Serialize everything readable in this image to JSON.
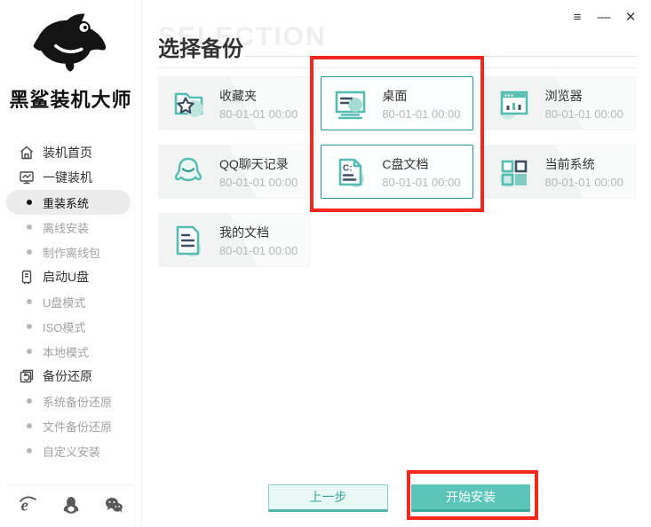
{
  "window": {
    "controls": {
      "menu": "≡",
      "minimize": "—",
      "close": "✕"
    }
  },
  "sidebar": {
    "app_name": "黑鲨装机大师",
    "logo_icon": "shark-logo",
    "items": [
      {
        "name": "home",
        "label": "装机首页",
        "type": "main",
        "icon": "home-icon"
      },
      {
        "name": "one-click-install",
        "label": "一键装机",
        "type": "main",
        "icon": "monitor-chart-icon"
      },
      {
        "name": "reinstall-system",
        "label": "重装系统",
        "type": "sub",
        "active": true
      },
      {
        "name": "offline-install",
        "label": "离线安装",
        "type": "sub"
      },
      {
        "name": "make-offline-package",
        "label": "制作离线包",
        "type": "sub"
      },
      {
        "name": "boot-usb",
        "label": "启动U盘",
        "type": "main",
        "icon": "usb-drive-icon"
      },
      {
        "name": "usb-mode",
        "label": "U盘模式",
        "type": "sub"
      },
      {
        "name": "iso-mode",
        "label": "ISO模式",
        "type": "sub"
      },
      {
        "name": "local-mode",
        "label": "本地模式",
        "type": "sub"
      },
      {
        "name": "backup-restore",
        "label": "备份还原",
        "type": "main",
        "icon": "backup-restore-icon"
      },
      {
        "name": "system-backup-restore",
        "label": "系统备份还原",
        "type": "sub"
      },
      {
        "name": "file-backup-restore",
        "label": "文件备份还原",
        "type": "sub"
      },
      {
        "name": "custom-install",
        "label": "自定义安装",
        "type": "sub"
      }
    ],
    "footer_icons": [
      "ie-browser-icon",
      "qq-icon",
      "wechat-icon"
    ]
  },
  "header": {
    "title": "选择备份",
    "watermark": "SELECTION"
  },
  "cards": [
    {
      "name": "favorites",
      "label": "收藏夹",
      "date": "80-01-01 00:00",
      "icon": "favorites-folder-icon",
      "selected": false
    },
    {
      "name": "desktop",
      "label": "桌面",
      "date": "80-01-01 00:00",
      "icon": "desktop-icon",
      "selected": true
    },
    {
      "name": "browser",
      "label": "浏览器",
      "date": "80-01-01 00:00",
      "icon": "browser-icon",
      "selected": false
    },
    {
      "name": "qq-chat-history",
      "label": "QQ聊天记录",
      "date": "80-01-01 00:00",
      "icon": "qq-chat-icon",
      "selected": false
    },
    {
      "name": "c-drive-docs",
      "label": "C盘文档",
      "date": "80-01-01 00:00",
      "icon": "c-drive-doc-icon",
      "selected": true
    },
    {
      "name": "current-system",
      "label": "当前系统",
      "date": "80-01-01 00:00",
      "icon": "current-system-icon",
      "selected": false
    },
    {
      "name": "my-documents",
      "label": "我的文档",
      "date": "80-01-01 00:00",
      "icon": "my-documents-icon",
      "selected": false
    }
  ],
  "buttons": {
    "back": "上一步",
    "install": "开始安装"
  },
  "colors": {
    "accent_teal": "#56bdb2",
    "accent_dark": "#3ea79b",
    "navy": "#3d4e63",
    "selected_border": "#2596a2",
    "annotation_red": "#f5281b"
  }
}
